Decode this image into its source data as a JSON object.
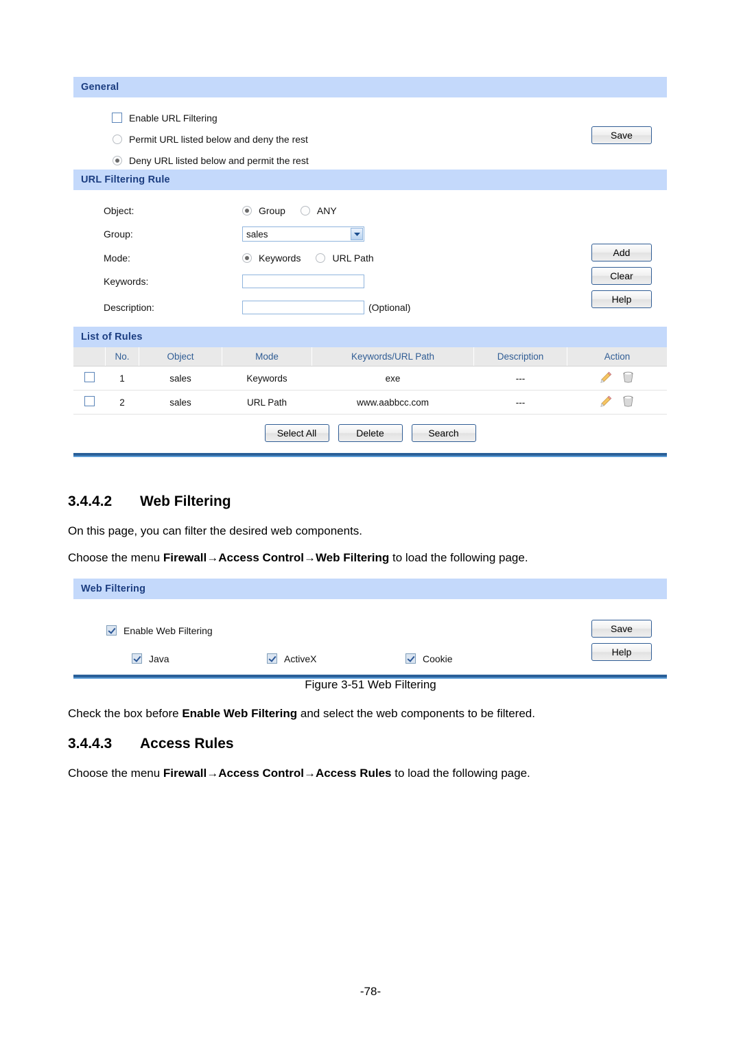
{
  "panels": {
    "general": {
      "title": "General",
      "enable_checkbox_label": "Enable URL Filtering",
      "radio_permit_label": "Permit URL listed below and deny the rest",
      "radio_deny_label": "Deny URL listed below and permit the rest",
      "save_label": "Save"
    },
    "url_filtering_rule": {
      "title": "URL Filtering Rule",
      "object_label": "Object:",
      "object_option_group": "Group",
      "object_option_any": "ANY",
      "group_label": "Group:",
      "group_value": "sales",
      "mode_label": "Mode:",
      "mode_option_keywords": "Keywords",
      "mode_option_urlpath": "URL Path",
      "keywords_label": "Keywords:",
      "keywords_value": "",
      "description_label": "Description:",
      "description_value": "",
      "optional_note": "(Optional)",
      "add_label": "Add",
      "clear_label": "Clear",
      "help_label": "Help"
    },
    "list_of_rules": {
      "title": "List of Rules",
      "columns": [
        "",
        "No.",
        "Object",
        "Mode",
        "Keywords/URL Path",
        "Description",
        "Action"
      ],
      "rows": [
        {
          "no": "1",
          "object": "sales",
          "mode": "Keywords",
          "keywords": "exe",
          "description": "---"
        },
        {
          "no": "2",
          "object": "sales",
          "mode": "URL Path",
          "keywords": "www.aabbcc.com",
          "description": "---"
        }
      ],
      "select_all_label": "Select All",
      "delete_label": "Delete",
      "search_label": "Search"
    },
    "web_filtering": {
      "title": "Web Filtering",
      "enable_label": "Enable Web Filtering",
      "component_java": "Java",
      "component_activex": "ActiveX",
      "component_cookie": "Cookie",
      "save_label": "Save",
      "help_label": "Help"
    }
  },
  "document": {
    "section_web_filtering": {
      "number": "3.4.4.2",
      "title": "Web Filtering",
      "para1": "On this page, you can filter the desired web components.",
      "para2_prefix": "Choose the menu ",
      "para2_bold1": "Firewall",
      "para2_arrow1": "→",
      "para2_bold2": "Access Control",
      "para2_arrow2": "→",
      "para2_bold3": "Web Filtering",
      "para2_suffix": " to load the following page."
    },
    "figure_caption": "Figure 3-51 Web Filtering",
    "para_after_figure": {
      "prefix": "Check the box before ",
      "bold": "Enable Web Filtering",
      "suffix": " and select the web components to be filtered."
    },
    "section_access_rules": {
      "number": "3.4.4.3",
      "title": "Access Rules",
      "para_prefix": "Choose the menu ",
      "para_bold1": "Firewall",
      "para_arrow1": "→",
      "para_bold2": "Access Control",
      "para_arrow2": "→",
      "para_bold3": "Access Rules",
      "para_suffix": " to load the following page."
    },
    "page_number": "-78-"
  },
  "colors": {
    "panel_header_bg": "#c4d9fb",
    "panel_header_text": "#1b3d80",
    "rule_line": "#2a6099",
    "table_header_bg": "#e9e9e9",
    "table_header_text": "#2f5c94",
    "button_border": "#2f5c94"
  }
}
